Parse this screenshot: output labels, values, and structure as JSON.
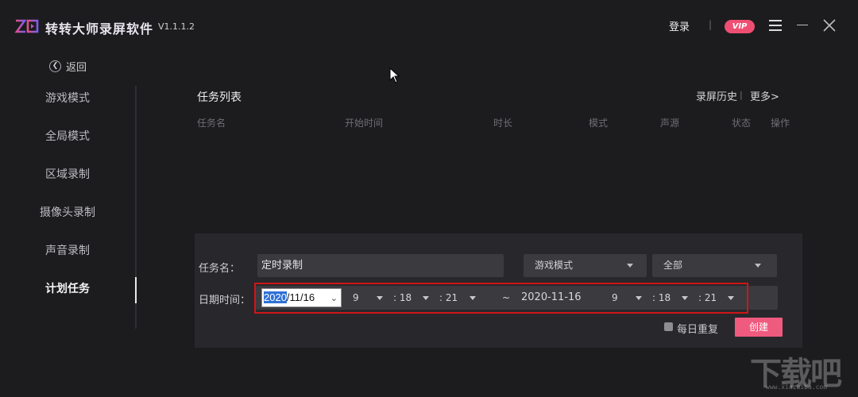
{
  "app": {
    "name": "转转大师录屏软件",
    "version": "V1.1.1.2",
    "login_label": "登录",
    "separator": "|",
    "vip_label": "VIP",
    "icons": [
      "logo-icon",
      "menu-icon",
      "minimize-icon",
      "close-icon"
    ]
  },
  "back": {
    "label": "返回"
  },
  "sidebar": {
    "items": [
      {
        "label": "游戏模式"
      },
      {
        "label": "全局模式"
      },
      {
        "label": "区域录制"
      },
      {
        "label": "摄像头录制"
      },
      {
        "label": "声音录制"
      },
      {
        "label": "计划任务",
        "active": true
      }
    ]
  },
  "tasklist": {
    "title": "任务列表",
    "history_label": "录屏历史",
    "separator": "|",
    "more_label": "更多>",
    "columns": [
      "任务名",
      "开始时间",
      "时长",
      "模式",
      "声源",
      "状态",
      "操作"
    ]
  },
  "form": {
    "task_name_label": "任务名：",
    "task_name_value": "定时录制",
    "mode_select": "游戏模式",
    "area_select": "全部",
    "datetime_label": "日期时间：",
    "start_date_selected": "2020",
    "start_date_rest": "/11/16",
    "start_hour": "9",
    "start_minute": ": 18",
    "start_second": ": 21",
    "tilde": "~",
    "end_date": "2020-11-16",
    "end_hour": "9",
    "end_minute": ": 18",
    "end_second": ": 21",
    "repeat_label": "每日重复",
    "repeat_checked": false,
    "create_label": "创建"
  },
  "watermark": {
    "text": "下载吧",
    "url": "www.xiazaiba.com"
  },
  "colors": {
    "background": "#1c1c1f",
    "panel": "#28282c",
    "accent": "#ef5a7f",
    "vip": "#ef4e73",
    "highlight_border": "#d01616",
    "selection": "#2f71d6"
  }
}
